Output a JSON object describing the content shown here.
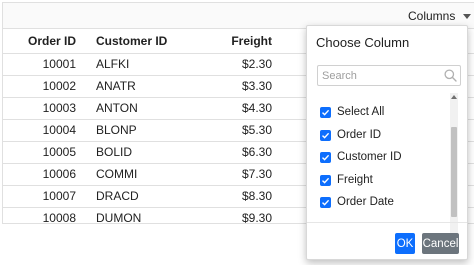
{
  "toolbar": {
    "columns_label": "Columns"
  },
  "grid": {
    "headers": {
      "order_id": "Order ID",
      "customer_id": "Customer ID",
      "freight": "Freight"
    },
    "rows": [
      {
        "order_id": "10001",
        "customer_id": "ALFKI",
        "freight": "$2.30"
      },
      {
        "order_id": "10002",
        "customer_id": "ANATR",
        "freight": "$3.30"
      },
      {
        "order_id": "10003",
        "customer_id": "ANTON",
        "freight": "$4.30"
      },
      {
        "order_id": "10004",
        "customer_id": "BLONP",
        "freight": "$5.30"
      },
      {
        "order_id": "10005",
        "customer_id": "BOLID",
        "freight": "$6.30"
      },
      {
        "order_id": "10006",
        "customer_id": "COMMI",
        "freight": "$7.30"
      },
      {
        "order_id": "10007",
        "customer_id": "DRACD",
        "freight": "$8.30"
      },
      {
        "order_id": "10008",
        "customer_id": "DUMON",
        "freight": "$9.30"
      }
    ]
  },
  "chooser": {
    "title": "Choose Column",
    "search_placeholder": "Search",
    "search_value": "",
    "items": [
      {
        "label": "Select All",
        "checked": true
      },
      {
        "label": "Order ID",
        "checked": true
      },
      {
        "label": "Customer ID",
        "checked": true
      },
      {
        "label": "Freight",
        "checked": true
      },
      {
        "label": "Order Date",
        "checked": true
      }
    ],
    "ok_label": "OK",
    "cancel_label": "Cancel"
  },
  "colors": {
    "accent": "#0d6efd",
    "cancel": "#6c757d",
    "border": "#e0e0e0"
  }
}
